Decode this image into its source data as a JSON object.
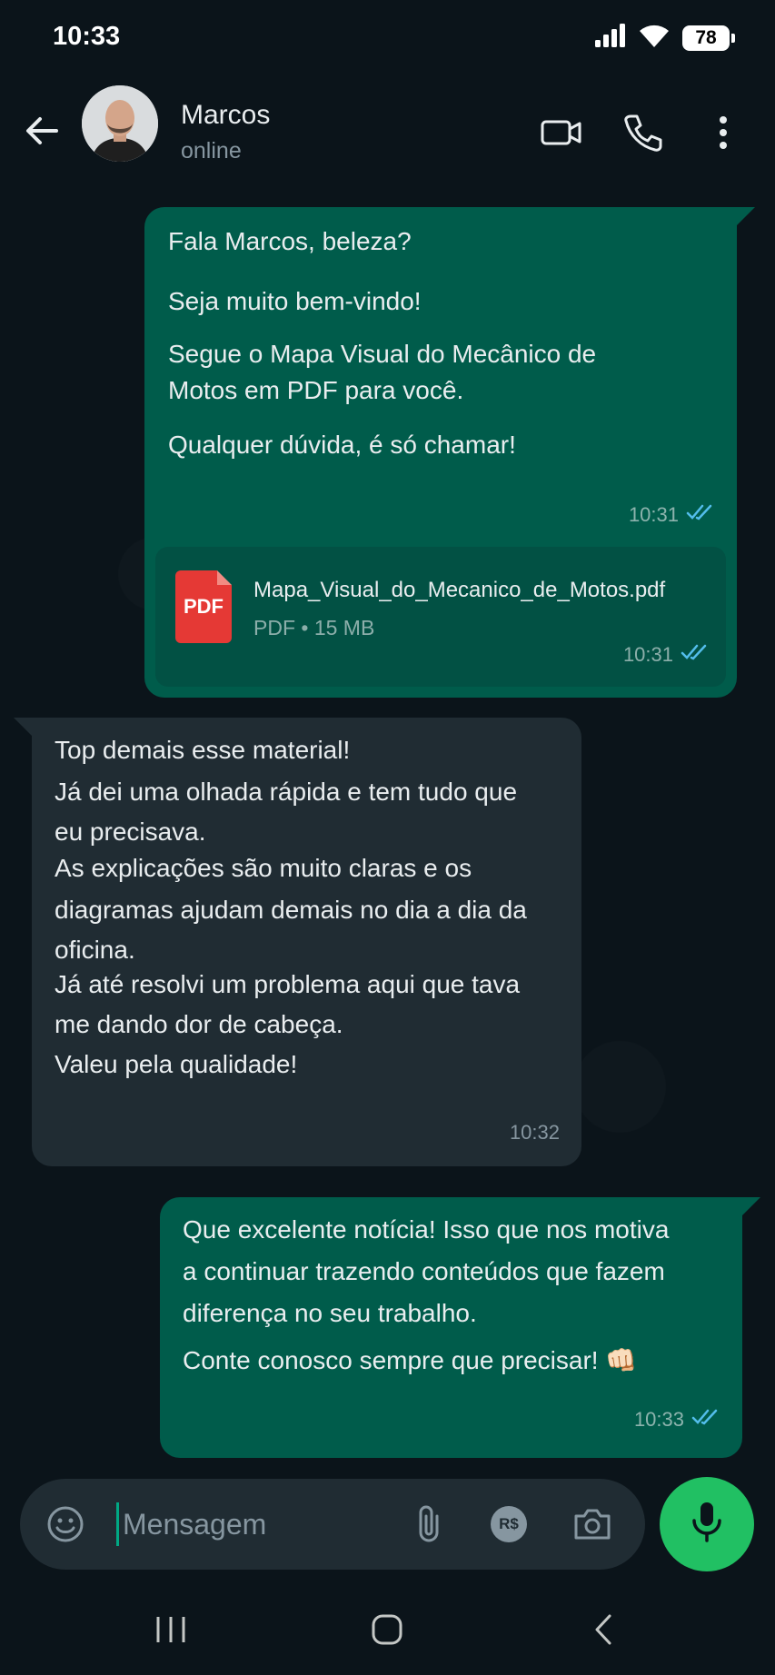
{
  "status_bar": {
    "time": "10:33",
    "battery": "78"
  },
  "header": {
    "name": "Marcos",
    "status": "online"
  },
  "messages": [
    {
      "direction": "out",
      "lines": [
        "Fala Marcos, beleza?",
        "Seja muito bem-vindo!",
        "Segue o Mapa Visual do Mecânico de",
        "Motos em PDF para você.",
        "Qualquer dúvida, é só chamar!"
      ],
      "time": "10:31",
      "read": true,
      "attachment": {
        "icon_label": "PDF",
        "filename": "Mapa_Visual_do_Mecanico_de_Motos.pdf",
        "meta": "PDF • 15 MB",
        "time": "10:31"
      }
    },
    {
      "direction": "in",
      "lines": [
        "Top demais esse material!",
        "Já dei uma olhada rápida e tem tudo que",
        "eu precisava.",
        "As explicações são muito claras e os",
        "diagramas ajudam demais no dia a dia da",
        "oficina.",
        "Já até resolvi um problema aqui que tava",
        "me dando dor de cabeça.",
        "Valeu pela qualidade!"
      ],
      "time": "10:32"
    },
    {
      "direction": "out",
      "lines": [
        "Que excelente notícia! Isso que nos motiva",
        "a continuar trazendo conteúdos que fazem",
        "diferença no seu trabalho.",
        "Conte conosco sempre que precisar! 👊🏻"
      ],
      "time": "10:33",
      "read": true
    }
  ],
  "composer": {
    "placeholder": "Mensagem",
    "currency_label": "R$"
  },
  "colors": {
    "outgoing": "#005c4b",
    "incoming": "#202c33",
    "accent": "#21c063",
    "read_ticks": "#53bdeb"
  }
}
